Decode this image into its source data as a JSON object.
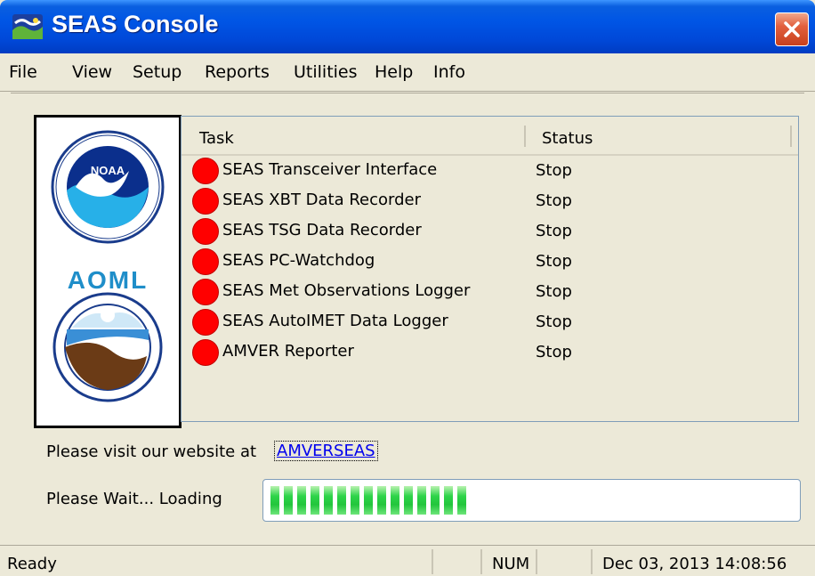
{
  "window": {
    "title": "SEAS Console",
    "close_icon": "close-icon",
    "accent": "#0055e5",
    "close_color": "#e2603e"
  },
  "menu": {
    "items": [
      {
        "label": "File"
      },
      {
        "label": "View"
      },
      {
        "label": "Setup"
      },
      {
        "label": "Reports"
      },
      {
        "label": "Utilities"
      },
      {
        "label": "Help"
      },
      {
        "label": "Info"
      }
    ]
  },
  "logos": {
    "noaa_text": "NOAA",
    "aoml_text": "AOML"
  },
  "task_list": {
    "columns": [
      "Task",
      "Status"
    ],
    "status_icon": "red-status-dot-icon",
    "status_color": "#ff0000",
    "rows": [
      {
        "task": "SEAS Transceiver Interface",
        "status": "Stop"
      },
      {
        "task": "SEAS XBT Data Recorder",
        "status": "Stop"
      },
      {
        "task": "SEAS TSG Data Recorder",
        "status": "Stop"
      },
      {
        "task": "SEAS PC-Watchdog",
        "status": "Stop"
      },
      {
        "task": "SEAS Met Observations Logger",
        "status": "Stop"
      },
      {
        "task": "SEAS AutoIMET Data Logger",
        "status": "Stop"
      },
      {
        "task": "AMVER Reporter",
        "status": "Stop"
      }
    ]
  },
  "website": {
    "prompt": "Please visit our website at",
    "link": "AMVERSEAS"
  },
  "loading": {
    "label": "Please Wait... Loading",
    "progress": 0.39,
    "bar_color": "#22c63c"
  },
  "statusbar": {
    "ready": "Ready",
    "num": "NUM",
    "datetime": "Dec 03, 2013 14:08:56"
  }
}
